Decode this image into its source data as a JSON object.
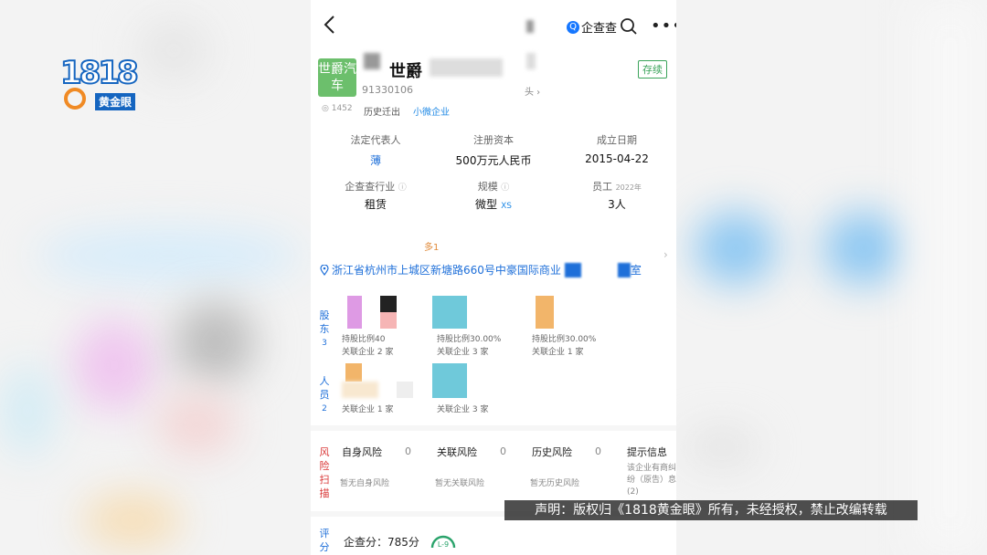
{
  "overlay": {
    "logo_number": "1818",
    "logo_name": "黄金眼",
    "disclaimer": "声明：版权归《1818黄金眼》所有，未经授权，禁止改编转载"
  },
  "topbar": {
    "brand_label": "企查查",
    "back_icon": "chevron-left-icon",
    "search_icon": "search-icon",
    "more_icon": "more-icon"
  },
  "company": {
    "logo_text": "世爵汽车",
    "name": "世爵",
    "credit_code": "91330106",
    "status": "存续",
    "more_link": "头 ›",
    "views": "1452",
    "tag_history": "历史迁出",
    "tag_size": "小微企业"
  },
  "info": {
    "legal_rep_label": "法定代表人",
    "legal_rep_value": "薄",
    "capital_label": "注册资本",
    "capital_value": "500万元人民币",
    "founded_label": "成立日期",
    "founded_value": "2015-04-22",
    "industry_label": "企查查行业",
    "industry_value": "租赁",
    "scale_label": "规模",
    "scale_value": "微型",
    "scale_tag": "XS",
    "staff_label": "员工",
    "staff_year": "2022年",
    "staff_value": "3人"
  },
  "address": {
    "more_count": "多1",
    "text": "浙江省杭州市上城区新塘路660号中豪国际商业",
    "suffix": "室"
  },
  "shareholders": {
    "label": "股东",
    "count": "3",
    "items": [
      {
        "ratio": "持股比例40",
        "related": "关联企业 2 家"
      },
      {
        "ratio": "持股比例30.00%",
        "related": "关联企业 3 家"
      },
      {
        "ratio": "持股比例30.00%",
        "related": "关联企业 1 家"
      }
    ]
  },
  "staff": {
    "label": "人员",
    "count": "2",
    "items": [
      {
        "related": "关联企业 1 家"
      },
      {
        "related": "关联企业 3 家"
      }
    ]
  },
  "risk": {
    "label": "风险扫描",
    "items": [
      {
        "title": "自身风险",
        "count": "0",
        "sub": "暂无自身风险"
      },
      {
        "title": "关联风险",
        "count": "0",
        "sub": "暂无关联风险"
      },
      {
        "title": "历史风险",
        "count": "0",
        "sub": "暂无历史风险"
      },
      {
        "title": "提示信息",
        "count": "",
        "sub": "该企业有商纠纷（原告）息 (2)"
      }
    ]
  },
  "rating": {
    "label": "评分",
    "score_text": "企查分：785分",
    "level": "L-9"
  }
}
